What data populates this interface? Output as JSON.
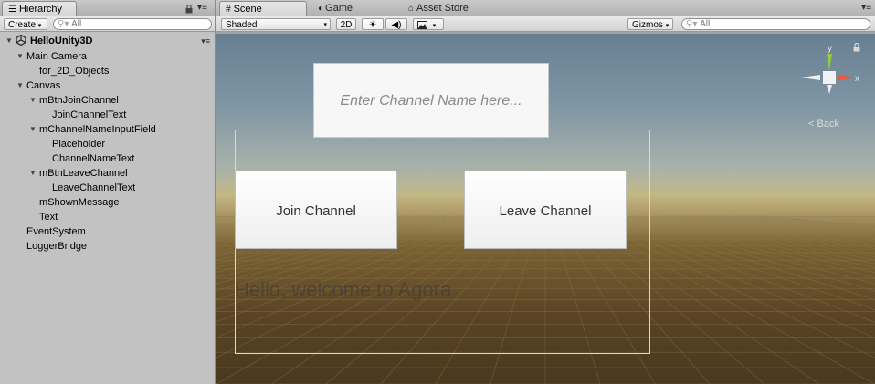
{
  "hierarchy": {
    "tab_label": "Hierarchy",
    "create_label": "Create",
    "search_placeholder": "All",
    "root": "HelloUnity3D",
    "items": [
      {
        "label": "Main Camera",
        "depth": 1,
        "expanded": true
      },
      {
        "label": "for_2D_Objects",
        "depth": 2,
        "expanded": null
      },
      {
        "label": "Canvas",
        "depth": 1,
        "expanded": true
      },
      {
        "label": "mBtnJoinChannel",
        "depth": 2,
        "expanded": true
      },
      {
        "label": "JoinChannelText",
        "depth": 3,
        "expanded": null
      },
      {
        "label": "mChannelNameInputField",
        "depth": 2,
        "expanded": true
      },
      {
        "label": "Placeholder",
        "depth": 3,
        "expanded": null
      },
      {
        "label": "ChannelNameText",
        "depth": 3,
        "expanded": null
      },
      {
        "label": "mBtnLeaveChannel",
        "depth": 2,
        "expanded": true
      },
      {
        "label": "LeaveChannelText",
        "depth": 3,
        "expanded": null
      },
      {
        "label": "mShownMessage",
        "depth": 2,
        "expanded": null
      },
      {
        "label": "Text",
        "depth": 2,
        "expanded": null
      },
      {
        "label": "EventSystem",
        "depth": 1,
        "expanded": null
      },
      {
        "label": "LoggerBridge",
        "depth": 1,
        "expanded": null
      }
    ]
  },
  "tabs": {
    "scene": "Scene",
    "game": "Game",
    "asset_store": "Asset Store"
  },
  "scene_toolbar": {
    "shading_mode": "Shaded",
    "mode_2d": "2D",
    "gizmos": "Gizmos",
    "search_placeholder": "All"
  },
  "scene_view": {
    "input_placeholder": "Enter Channel Name here...",
    "join_button": "Join Channel",
    "leave_button": "Leave Channel",
    "shown_message": "Hello, welcome to Agora",
    "gizmo_y": "y",
    "gizmo_x": "x",
    "back_label": "Back"
  },
  "icons": {
    "hierarchy_tab": "list-icon",
    "scene_tab": "grid-icon",
    "game_tab": "pacman-icon",
    "asset_store_tab": "shopping-bag-icon",
    "lighting": "sun-icon",
    "audio": "speaker-icon",
    "effects": "image-icon"
  }
}
